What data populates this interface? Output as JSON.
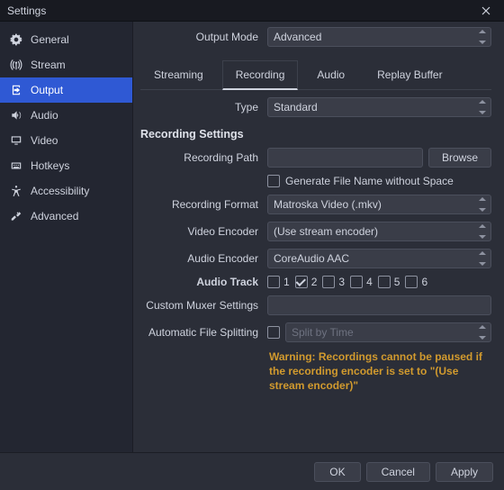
{
  "window": {
    "title": "Settings"
  },
  "sidebar": {
    "items": [
      {
        "label": "General"
      },
      {
        "label": "Stream"
      },
      {
        "label": "Output"
      },
      {
        "label": "Audio"
      },
      {
        "label": "Video"
      },
      {
        "label": "Hotkeys"
      },
      {
        "label": "Accessibility"
      },
      {
        "label": "Advanced"
      }
    ]
  },
  "outputMode": {
    "label": "Output Mode",
    "value": "Advanced"
  },
  "tabs": [
    "Streaming",
    "Recording",
    "Audio",
    "Replay Buffer"
  ],
  "type": {
    "label": "Type",
    "value": "Standard"
  },
  "sectionTitle": "Recording Settings",
  "recordingPath": {
    "label": "Recording Path",
    "value": ""
  },
  "browse": "Browse",
  "genFilename": {
    "label": "Generate File Name without Space"
  },
  "recordingFormat": {
    "label": "Recording Format",
    "value": "Matroska Video (.mkv)"
  },
  "videoEncoder": {
    "label": "Video Encoder",
    "value": "(Use stream encoder)"
  },
  "audioEncoder": {
    "label": "Audio Encoder",
    "value": "CoreAudio AAC"
  },
  "audioTrack": {
    "label": "Audio Track",
    "tracks": [
      "1",
      "2",
      "3",
      "4",
      "5",
      "6"
    ]
  },
  "customMuxer": {
    "label": "Custom Muxer Settings",
    "value": ""
  },
  "autoSplit": {
    "label": "Automatic File Splitting",
    "value": "Split by Time"
  },
  "warning": "Warning: Recordings cannot be paused if the recording encoder is set to \"(Use stream encoder)\"",
  "footer": {
    "ok": "OK",
    "cancel": "Cancel",
    "apply": "Apply"
  }
}
